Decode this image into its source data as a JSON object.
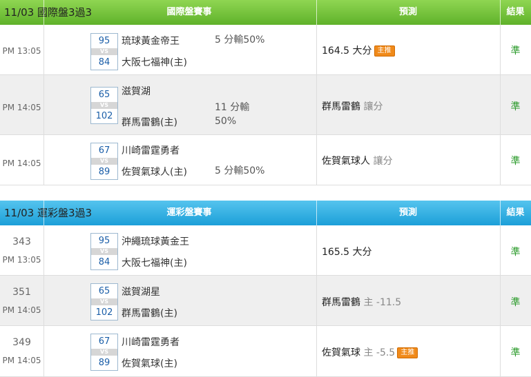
{
  "section1": {
    "header": {
      "date": "11/03 國際盤3過3",
      "event": "國際盤賽事",
      "prediction": "預測",
      "result": "結果"
    },
    "rows": [
      {
        "num": "",
        "time": "PM 13:05",
        "score_away": "95",
        "score_home": "84",
        "vs": "VS",
        "team_away": "琉球黃金帝王",
        "team_home": "大阪七福神(主)",
        "handicap": "5 分輸50%",
        "prediction": "164.5 大分",
        "prediction_sub": "",
        "badge": "主推",
        "result": "準"
      },
      {
        "num": "",
        "time": "PM 14:05",
        "score_away": "65",
        "score_home": "102",
        "vs": "VS",
        "team_away": "滋賀湖",
        "team_home": "群馬雷鶴(主)",
        "handicap_line1": "11 分輸",
        "handicap_line2": "50%",
        "prediction": "群馬雷鶴",
        "prediction_sub": "讓分",
        "result": "準"
      },
      {
        "num": "",
        "time": "PM 14:05",
        "score_away": "67",
        "score_home": "89",
        "vs": "VS",
        "team_away": "川崎雷霆勇者",
        "team_home": "佐賀氣球人(主)",
        "handicap": "5 分輸50%",
        "prediction": "佐賀氣球人",
        "prediction_sub": "讓分",
        "result": "準"
      }
    ]
  },
  "section2": {
    "header": {
      "date": "11/03 運彩盤3過3",
      "event": "運彩盤賽事",
      "prediction": "預測",
      "result": "結果"
    },
    "rows": [
      {
        "num": "343",
        "time": "PM 13:05",
        "score_away": "95",
        "score_home": "84",
        "vs": "VS",
        "team_away": "沖繩琉球黃金王",
        "team_home": "大阪七福神(主)",
        "prediction": "165.5 大分",
        "prediction_sub": "",
        "result": "準"
      },
      {
        "num": "351",
        "time": "PM 14:05",
        "score_away": "65",
        "score_home": "102",
        "vs": "VS",
        "team_away": "滋賀湖星",
        "team_home": "群馬雷鶴(主)",
        "prediction": "群馬雷鶴",
        "prediction_sub": "主 -11.5",
        "result": "準"
      },
      {
        "num": "349",
        "time": "PM 14:05",
        "score_away": "67",
        "score_home": "89",
        "vs": "VS",
        "team_away": "川崎雷霆勇者",
        "team_home": "佐賀氣球(主)",
        "prediction": "佐賀氣球",
        "prediction_sub": "主 -5.5",
        "badge": "主推",
        "result": "準"
      }
    ]
  },
  "colors": {
    "section1_header": "#6cc038",
    "section2_header": "#2aa9de",
    "result_text": "#2a9a2a",
    "badge": "#f08a1a",
    "score_text": "#1a5ea8"
  }
}
